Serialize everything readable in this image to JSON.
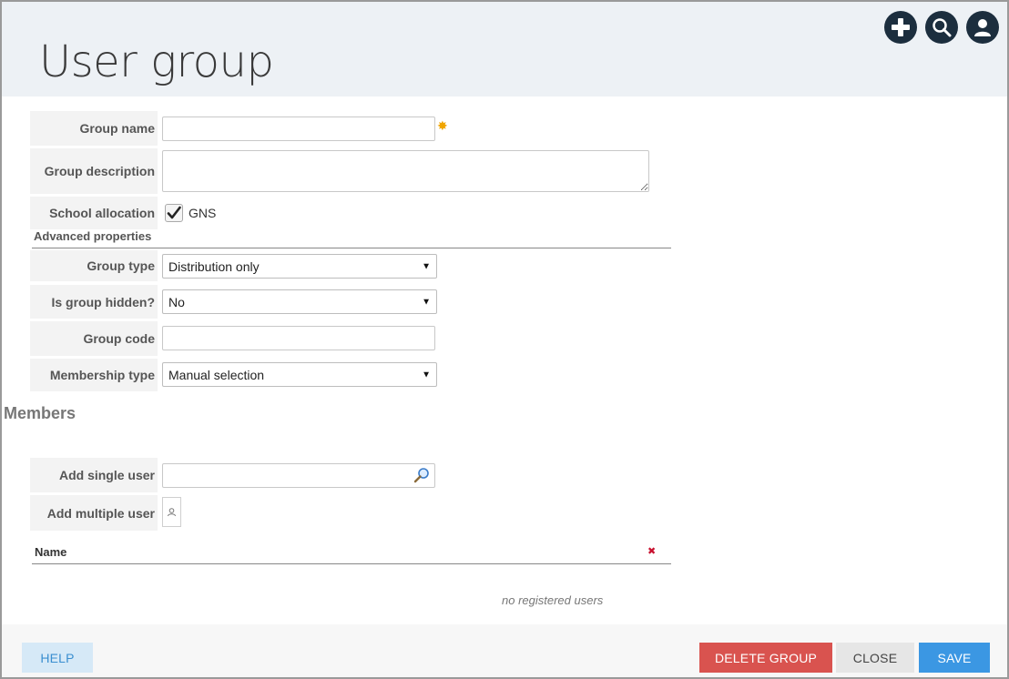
{
  "header": {
    "title": "User group",
    "actions": [
      {
        "icon": "plus-icon",
        "label": "Add"
      },
      {
        "icon": "search-icon",
        "label": "Search"
      },
      {
        "icon": "user-icon",
        "label": "Profile"
      }
    ]
  },
  "form": {
    "group_name": {
      "label": "Group name",
      "value": "",
      "required": true
    },
    "group_description": {
      "label": "Group description",
      "value": ""
    },
    "school_allocation": {
      "label": "School allocation",
      "checked": true,
      "option_label": "GNS"
    },
    "advanced_heading": "Advanced properties",
    "group_type": {
      "label": "Group type",
      "selected": "Distribution only"
    },
    "group_hidden": {
      "label": "Is group hidden?",
      "selected": "No"
    },
    "group_code": {
      "label": "Group code",
      "value": ""
    },
    "membership_type": {
      "label": "Membership type",
      "selected": "Manual selection"
    }
  },
  "members": {
    "heading": "Members",
    "add_single_user": {
      "label": "Add single user",
      "value": ""
    },
    "add_multiple_user": {
      "label": "Add multiple user"
    },
    "table": {
      "columns": [
        "Name"
      ],
      "rows": [],
      "empty_message": "no registered users"
    }
  },
  "footer": {
    "help_label": "HELP",
    "delete_label": "DELETE GROUP",
    "close_label": "CLOSE",
    "save_label": "SAVE"
  },
  "colors": {
    "header_bg": "#edf1f5",
    "icon_button": "#1c2e3e",
    "delete": "#d9534f",
    "save": "#3b97e3",
    "help_bg": "#d6e9f7",
    "required_star": "#f0a500"
  }
}
